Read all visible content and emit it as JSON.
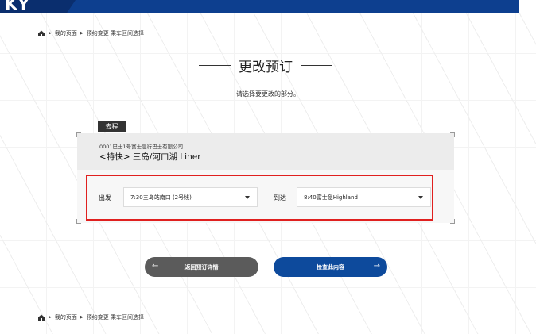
{
  "header": {
    "logo_text": "KY"
  },
  "breadcrumb": {
    "home": "我的页面",
    "current": "预约变更·乘车区间选择"
  },
  "page": {
    "title": "更改预订",
    "subtitle": "请选择要更改的部分。"
  },
  "trip": {
    "tag": "去程",
    "company": "0001巴士1号富士急行巴士有限公司",
    "route": "<特快> 三岛/河口湖 Liner",
    "departure_label": "出发",
    "departure_value": "7:30三岛站南口 (2号线)",
    "arrival_label": "到达",
    "arrival_value": "8:40富士急Highland"
  },
  "buttons": {
    "back_label": "返回预订详情",
    "back_icon": "arrow-left-icon",
    "next_label": "检查此内容",
    "next_icon": "arrow-right-icon"
  },
  "colors": {
    "brand": "#0d3f8f",
    "next_button": "#0d4a9c",
    "back_button": "#5b5b5b",
    "highlight": "#e0201f"
  }
}
